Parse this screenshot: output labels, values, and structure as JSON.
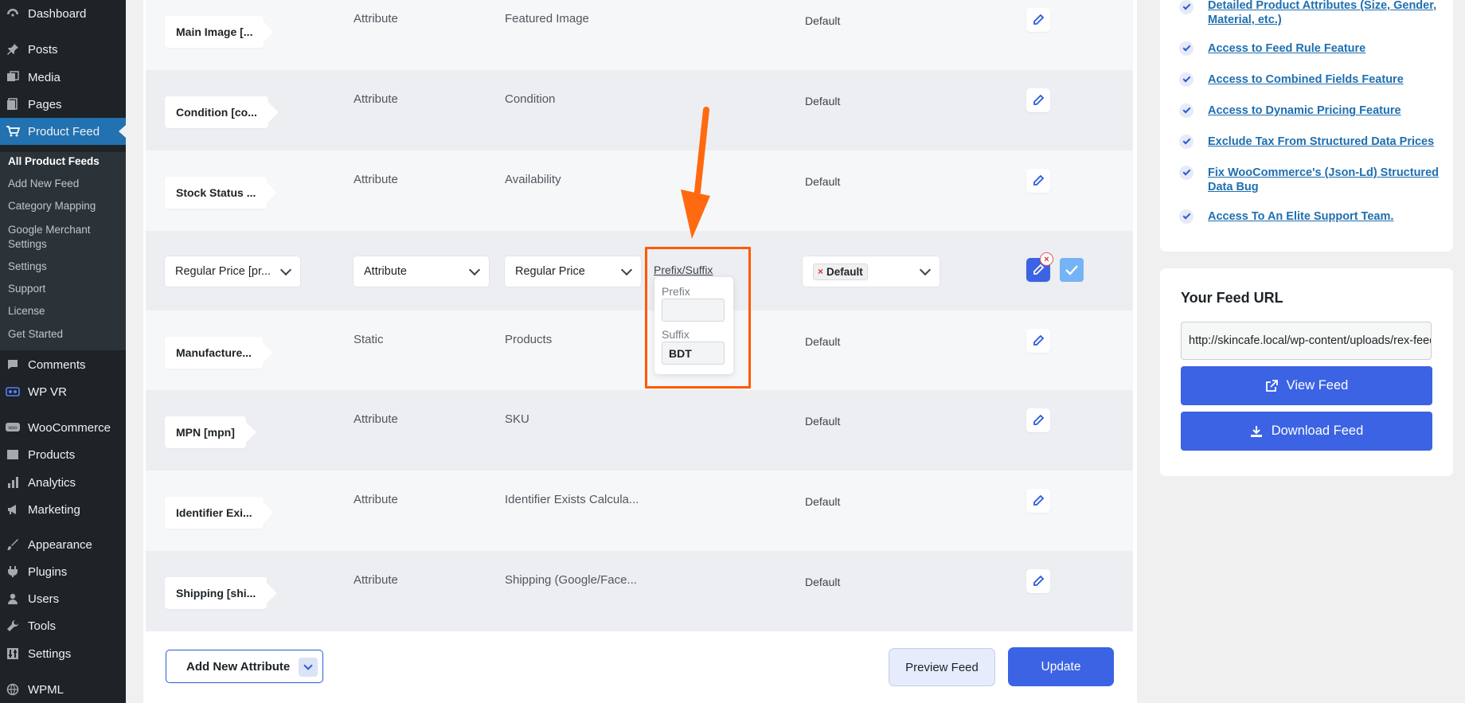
{
  "sidebar": {
    "items": [
      {
        "label": "Dashboard",
        "icon": "dashboard-icon"
      },
      {
        "label": "Posts",
        "icon": "pin-icon"
      },
      {
        "label": "Media",
        "icon": "media-icon"
      },
      {
        "label": "Pages",
        "icon": "pages-icon"
      },
      {
        "label": "Product Feed",
        "icon": "cart-icon"
      },
      {
        "label": "Comments",
        "icon": "comment-icon"
      },
      {
        "label": "WP VR",
        "icon": "vr-icon"
      },
      {
        "label": "WooCommerce",
        "icon": "woo-icon"
      },
      {
        "label": "Products",
        "icon": "products-icon"
      },
      {
        "label": "Analytics",
        "icon": "analytics-icon"
      },
      {
        "label": "Marketing",
        "icon": "megaphone-icon"
      },
      {
        "label": "Appearance",
        "icon": "brush-icon"
      },
      {
        "label": "Plugins",
        "icon": "plug-icon"
      },
      {
        "label": "Users",
        "icon": "user-icon"
      },
      {
        "label": "Tools",
        "icon": "wrench-icon"
      },
      {
        "label": "Settings",
        "icon": "settings-icon"
      },
      {
        "label": "WPML",
        "icon": "globe-icon"
      }
    ],
    "submenu": [
      "All Product Feeds",
      "Add New Feed",
      "Category Mapping",
      "Google Merchant Settings",
      "Settings",
      "Support",
      "License",
      "Get Started"
    ]
  },
  "rows": [
    {
      "name": "Main Image [...",
      "type": "Attribute",
      "value": "Featured Image",
      "output": "Default"
    },
    {
      "name": "Condition [co...",
      "type": "Attribute",
      "value": "Condition",
      "output": "Default"
    },
    {
      "name": "Stock Status ...",
      "type": "Attribute",
      "value": "Availability",
      "output": "Default"
    },
    {
      "name": "Manufacture...",
      "type": "Static",
      "value": "Products",
      "output": "Default"
    },
    {
      "name": "MPN [mpn]",
      "type": "Attribute",
      "value": "SKU",
      "output": "Default"
    },
    {
      "name": "Identifier Exi...",
      "type": "Attribute",
      "value": "Identifier Exists Calcula...",
      "output": "Default"
    },
    {
      "name": "Shipping [shi...",
      "type": "Attribute",
      "value": "Shipping (Google/Face...",
      "output": "Default"
    }
  ],
  "editing_row": {
    "name_select": "Regular Price [pr...",
    "type_select": "Attribute",
    "value_select": "Regular Price",
    "prefix_suffix_link": "Prefix/Suffix",
    "prefix_label": "Prefix",
    "prefix_value": "",
    "suffix_label": "Suffix",
    "suffix_value": "BDT",
    "output_tag": "Default",
    "output_tag_remove": "×"
  },
  "footer": {
    "add_attribute": "Add New Attribute",
    "preview": "Preview Feed",
    "update": "Update"
  },
  "features": [
    "Detailed Product Attributes (Size, Gender, Material, etc.)",
    "Access to Feed Rule Feature",
    "Access to Combined Fields Feature",
    "Access to Dynamic Pricing Feature",
    "Exclude Tax From Structured Data Prices",
    "Fix WooCommerce's (Json-Ld) Structured Data Bug",
    "Access To An Elite Support Team."
  ],
  "feed": {
    "heading": "Your Feed URL",
    "url": "http://skincafe.local/wp-content/uploads/rex-feed",
    "view": "View Feed",
    "download": "Download Feed"
  },
  "colors": {
    "accent": "#3b63e3",
    "highlight": "#ff5a00",
    "admin_bar": "#1d2327",
    "wp_blue": "#2271b1"
  }
}
